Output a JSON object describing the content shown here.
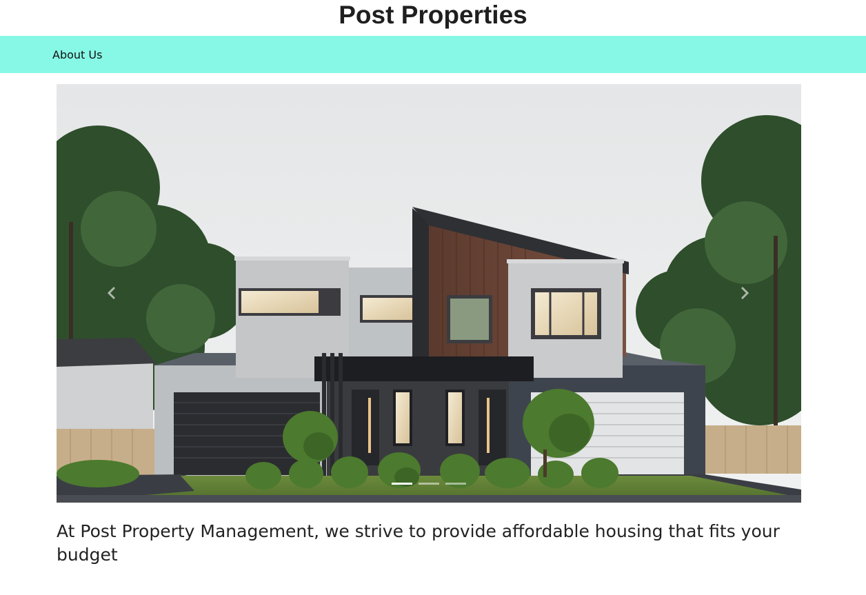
{
  "header": {
    "title": "Post Properties"
  },
  "nav": {
    "items": [
      {
        "label": "Us"
      },
      {
        "label": "About Us"
      }
    ]
  },
  "carousel": {
    "image_subject": "modern two-storey house with garages and trees",
    "slide_count": 3,
    "active_slide": 1,
    "prev_icon": "chevron-left-icon",
    "next_icon": "chevron-right-icon"
  },
  "main": {
    "tagline": "At Post Property Management, we strive to provide affordable housing that fits your budget"
  },
  "colors": {
    "navbar_background": "#87f8e6",
    "title_text": "#1f1f1f",
    "body_text": "#222222"
  }
}
